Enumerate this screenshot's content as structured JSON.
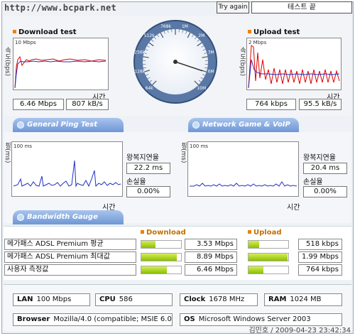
{
  "header": {
    "url": "http://www.bcpark.net",
    "try_again": "Try again",
    "status": "테스트 끝"
  },
  "download": {
    "title": "Download test",
    "scale": "10 Mbps",
    "yaxis": "속도(bps)",
    "xaxis": "시간",
    "mbps": "6.46 Mbps",
    "kbs": "807 kB/s"
  },
  "upload": {
    "title": "Upload test",
    "scale": "2 Mbps",
    "yaxis": "속도(bps)",
    "xaxis": "시간",
    "kbps": "764 kbps",
    "kbs": "95.5 kB/s"
  },
  "gauge": {
    "labels": [
      "64k",
      "128k",
      "256k",
      "512k",
      "768k",
      "1M",
      "2M",
      "3M",
      "6M",
      "10M"
    ],
    "needle_value_mbps": 6.46
  },
  "tabs": {
    "ping": "General Ping Test",
    "network": "Network Game & VoIP Test",
    "bandwidth": "Bandwidth Gauge"
  },
  "ping_general": {
    "scale": "100 ms",
    "yaxis": "핑(ms)",
    "xaxis": "시간",
    "rtt_label": "왕복지연율",
    "rtt_value": "22.2 ms",
    "loss_label": "손실율",
    "loss_value": "0.00%"
  },
  "ping_network": {
    "scale": "100 ms",
    "yaxis": "핑(ms)",
    "xaxis": "시간",
    "rtt_label": "왕복지연율",
    "rtt_value": "20.4 ms",
    "loss_label": "손실율",
    "loss_value": "0.00%"
  },
  "bandwidth": {
    "download_head": "Download",
    "upload_head": "Upload",
    "rows": [
      {
        "label": "메가패스 ADSL Premium 평균",
        "down": "3.53 Mbps",
        "down_fraction": 0.35,
        "up": "518 kbps",
        "up_fraction": 0.26
      },
      {
        "label": "메가패스 ADSL Premium 최대값",
        "down": "8.89 Mbps",
        "down_fraction": 0.89,
        "up": "1.99 Mbps",
        "up_fraction": 0.99
      },
      {
        "label": "사용자 측정값",
        "down": "6.46 Mbps",
        "down_fraction": 0.65,
        "up": "764 kbps",
        "up_fraction": 0.38
      }
    ]
  },
  "info": {
    "lan_label": "LAN",
    "lan_value": "100 Mbps",
    "cpu_label": "CPU",
    "cpu_value": "586",
    "clock_label": "Clock",
    "clock_value": "1678 MHz",
    "ram_label": "RAM",
    "ram_value": "1024 MB",
    "browser_label": "Browser",
    "browser_value": "Mozilla/4.0 (compatible; MSIE 6.0",
    "os_label": "OS",
    "os_value": "Microsoft Windows Server 2003"
  },
  "footer": "김민호 / 2009-04-23 23:42:34",
  "colors": {
    "accent": "#f08000",
    "tab": "#6f96d6",
    "bar": "#8cc000",
    "series_red": "#e00000",
    "series_blue": "#2030c0"
  }
}
